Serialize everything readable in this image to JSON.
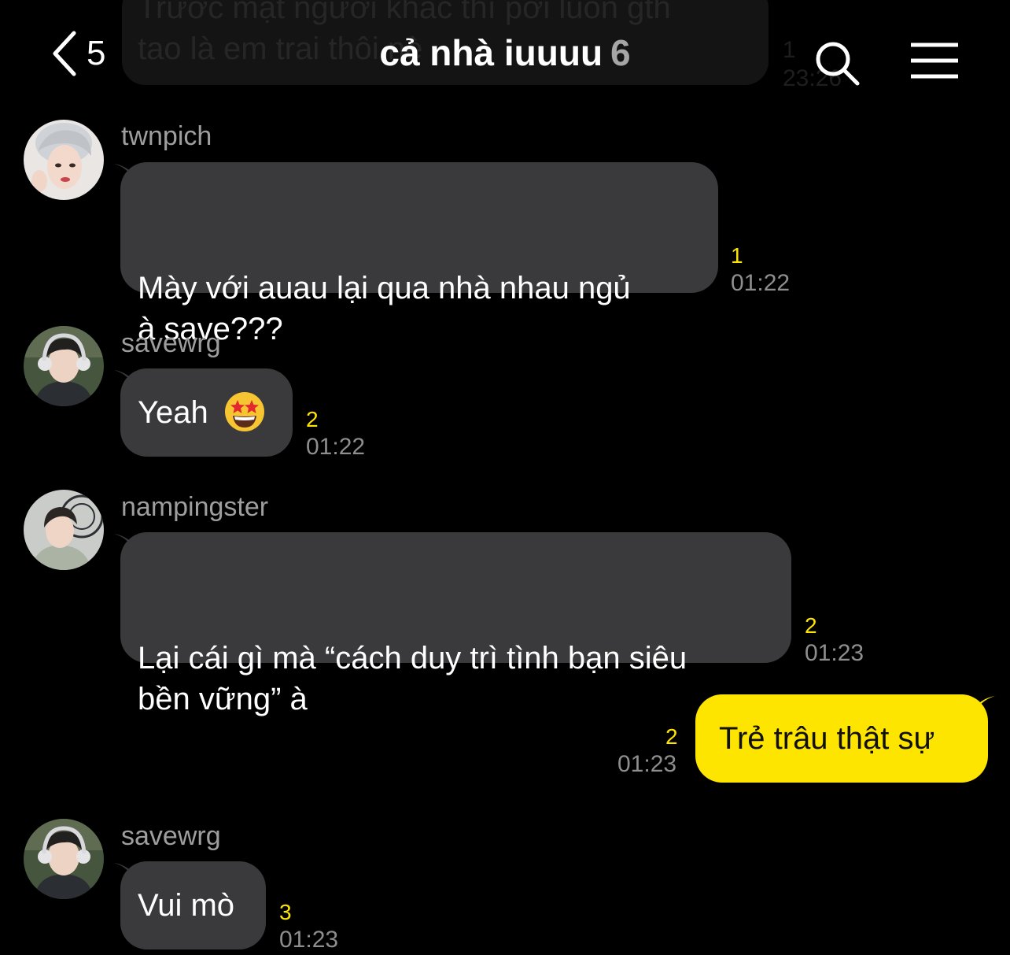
{
  "previous_message": {
    "text": "Trước mặt người khác thì pơi luôn gth\ntao là em trai thôi nè",
    "unread": "1",
    "time": "23:26"
  },
  "header": {
    "back_count": "5",
    "title": "cả nhà iuuuu",
    "member_count": "6"
  },
  "messages": [
    {
      "sender": "twnpich",
      "text": "Mày với auau lại qua nhà nhau ngủ\nà save???",
      "unread": "1",
      "time": "01:22"
    },
    {
      "sender": "savewrg",
      "text": "Yeah",
      "emoji": "star-struck-emoji",
      "unread": "2",
      "time": "01:22"
    },
    {
      "sender": "nampingster",
      "text": "Lại cái gì mà “cách duy trì tình bạn siêu\nbền vững” à",
      "unread": "2",
      "time": "01:23"
    },
    {
      "sender": "me",
      "text": "Trẻ trâu thật sự",
      "unread": "2",
      "time": "01:23"
    },
    {
      "sender": "savewrg",
      "text": "Vui mò",
      "unread": "3",
      "time": "01:23"
    }
  ],
  "colors": {
    "background": "#000000",
    "incoming_bubble": "#3a3a3c",
    "outgoing_bubble": "#fee500",
    "unread_count": "#fee500",
    "timestamp": "#8e8e8e"
  },
  "icons": [
    "chevron-left-icon",
    "search-icon",
    "menu-icon"
  ]
}
